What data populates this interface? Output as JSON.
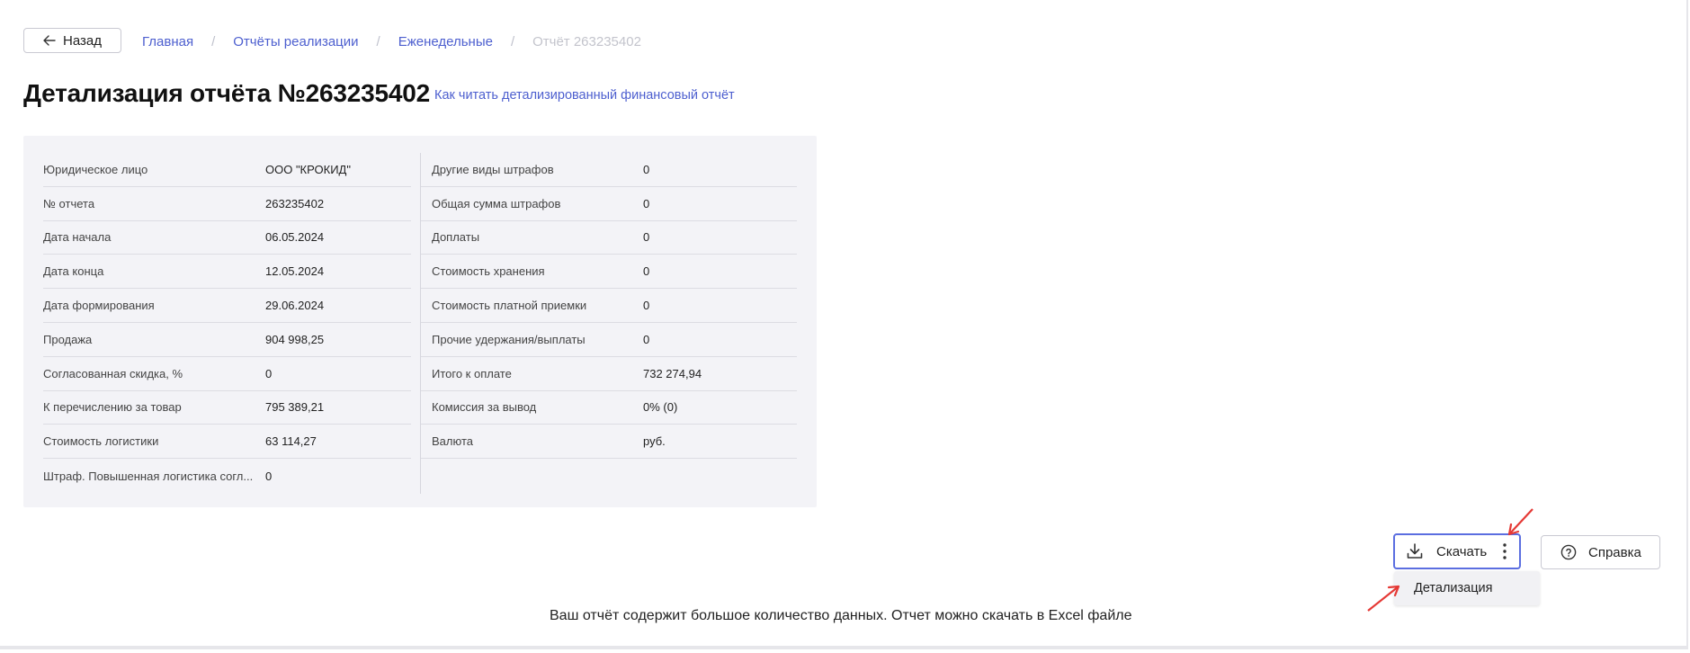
{
  "breadcrumb": {
    "back_label": "Назад",
    "items": [
      "Главная",
      "Отчёты реализации",
      "Еженедельные"
    ],
    "current": "Отчёт 263235402",
    "separator": "/"
  },
  "title": "Детализация отчёта №263235402",
  "help_link": "Как читать детализированный финансовый отчёт",
  "details_left": [
    {
      "label": "Юридическое лицо",
      "value": "ООО \"КРОКИД\""
    },
    {
      "label": "№ отчета",
      "value": "263235402"
    },
    {
      "label": "Дата начала",
      "value": "06.05.2024"
    },
    {
      "label": "Дата конца",
      "value": "12.05.2024"
    },
    {
      "label": "Дата формирования",
      "value": "29.06.2024"
    },
    {
      "label": "Продажа",
      "value": "904 998,25"
    },
    {
      "label": "Согласованная скидка, %",
      "value": "0"
    },
    {
      "label": "К перечислению за товар",
      "value": "795 389,21"
    },
    {
      "label": "Стоимость логистики",
      "value": "63 114,27"
    },
    {
      "label": "Штраф. Повышенная логистика согл...",
      "value": "0"
    }
  ],
  "details_right": [
    {
      "label": "Другие виды штрафов",
      "value": "0"
    },
    {
      "label": "Общая сумма штрафов",
      "value": "0"
    },
    {
      "label": "Доплаты",
      "value": "0"
    },
    {
      "label": "Стоимость хранения",
      "value": "0"
    },
    {
      "label": "Стоимость платной приемки",
      "value": "0"
    },
    {
      "label": "Прочие удержания/выплаты",
      "value": "0"
    },
    {
      "label": "Итого к оплате",
      "value": "732 274,94"
    },
    {
      "label": "Комиссия за вывод",
      "value": "0% (0)"
    },
    {
      "label": "Валюта",
      "value": "руб."
    }
  ],
  "actions": {
    "download_label": "Скачать",
    "reference_label": "Справка",
    "dropdown_item": "Детализация"
  },
  "notice": "Ваш отчёт содержит большое количество данных. Отчет можно скачать в Excel файле",
  "colors": {
    "accent": "#4d5fcf",
    "panel_bg": "#f3f3f7",
    "annotation_arrow": "#e53935"
  }
}
